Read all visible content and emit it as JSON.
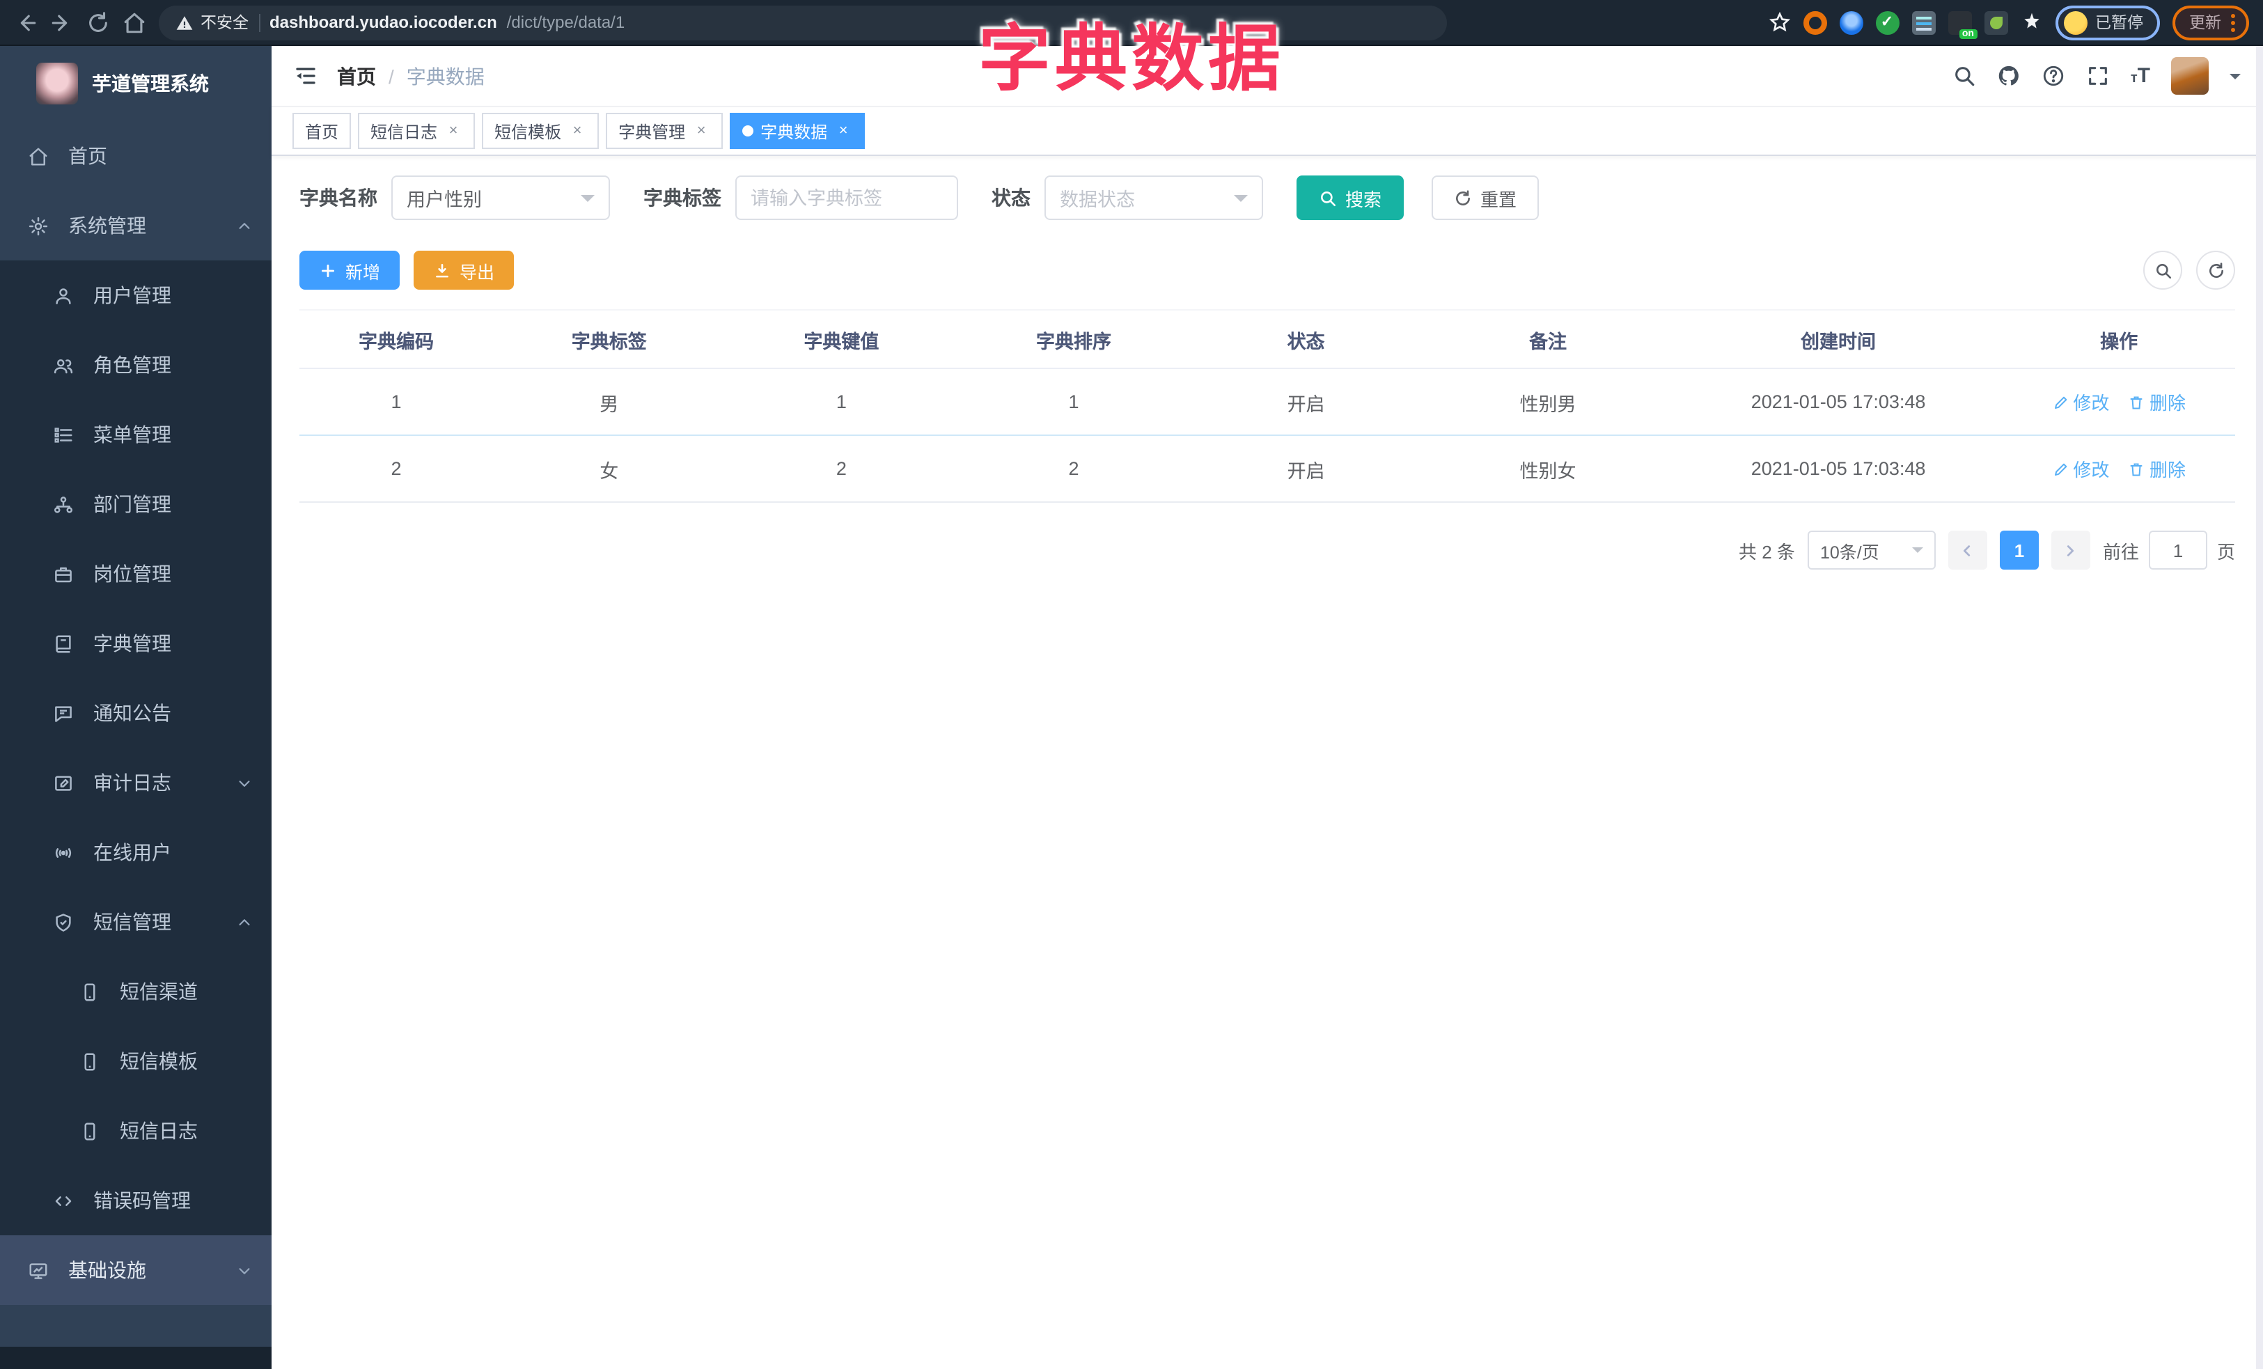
{
  "browser": {
    "security_label": "不安全",
    "url_host": "dashboard.yudao.iocoder.cn",
    "url_path": "/dict/type/data/1",
    "profile_status": "已暂停",
    "update_label": "更新",
    "extension_on_badge": "on"
  },
  "overlay": {
    "title": "字典数据",
    "color": "#f5365c"
  },
  "sidebar": {
    "title": "芋道管理系统",
    "items": [
      {
        "label": "首页"
      },
      {
        "label": "系统管理"
      },
      {
        "label": "用户管理"
      },
      {
        "label": "角色管理"
      },
      {
        "label": "菜单管理"
      },
      {
        "label": "部门管理"
      },
      {
        "label": "岗位管理"
      },
      {
        "label": "字典管理"
      },
      {
        "label": "通知公告"
      },
      {
        "label": "审计日志"
      },
      {
        "label": "在线用户"
      },
      {
        "label": "短信管理"
      },
      {
        "label": "短信渠道"
      },
      {
        "label": "短信模板"
      },
      {
        "label": "短信日志"
      },
      {
        "label": "错误码管理"
      },
      {
        "label": "基础设施"
      }
    ]
  },
  "breadcrumb": {
    "home": "首页",
    "separator": "/",
    "current": "字典数据"
  },
  "tabs": [
    {
      "label": "首页"
    },
    {
      "label": "短信日志"
    },
    {
      "label": "短信模板"
    },
    {
      "label": "字典管理"
    },
    {
      "label": "字典数据"
    }
  ],
  "filters": {
    "dict_name_label": "字典名称",
    "dict_name_value": "用户性别",
    "dict_label_label": "字典标签",
    "dict_label_placeholder": "请输入字典标签",
    "status_label": "状态",
    "status_placeholder": "数据状态",
    "search_label": "搜索",
    "reset_label": "重置"
  },
  "toolbar": {
    "add_label": "新增",
    "export_label": "导出"
  },
  "table": {
    "headers": [
      "字典编码",
      "字典标签",
      "字典键值",
      "字典排序",
      "状态",
      "备注",
      "创建时间",
      "操作"
    ],
    "rows": [
      {
        "code": "1",
        "label": "男",
        "value": "1",
        "sort": "1",
        "status": "开启",
        "remark": "性别男",
        "created": "2021-01-05 17:03:48"
      },
      {
        "code": "2",
        "label": "女",
        "value": "2",
        "sort": "2",
        "status": "开启",
        "remark": "性别女",
        "created": "2021-01-05 17:03:48"
      }
    ],
    "edit_label": "修改",
    "delete_label": "删除"
  },
  "pagination": {
    "total": "共 2 条",
    "page_size": "10条/页",
    "current_page": "1",
    "goto_label": "前往",
    "goto_value": "1",
    "page_unit": "页"
  },
  "colors": {
    "accent": "#409eff",
    "teal": "#17b3a3",
    "warning": "#efa030",
    "sidebar": "#304156",
    "overlay": "#f5365c"
  }
}
